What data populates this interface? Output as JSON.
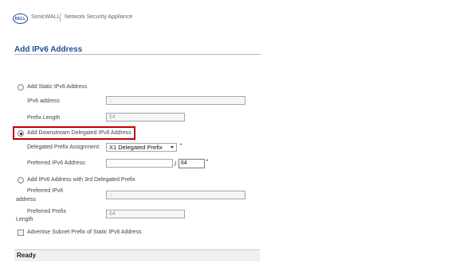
{
  "header": {
    "logo_text": "DELL",
    "brand": "SonicWALL",
    "product": "Network Security Appliance"
  },
  "page_title": "Add IPv6 Address",
  "static": {
    "radio_label": "Add Static IPv6 Address",
    "address_label": "IPv6 address",
    "address_value": "::",
    "prefix_label": "Prefix Length",
    "prefix_value": "64"
  },
  "downstream": {
    "radio_label": "Add Downstream Delegated IPv6 Address",
    "assignment_label": "Delegated Prefix Assignment:",
    "assignment_value": "X1 Delegated Prefix",
    "preferred_label": "Preferred IPv6 Address:",
    "preferred_value": "::",
    "separator": "/",
    "prefix_len_value": "64"
  },
  "third_party": {
    "radio_label": "Add IPv6 Address with 3rd Delegated Prefix",
    "preferred_address_label_1": "Preferred IPv6",
    "preferred_address_label_2": "address",
    "preferred_address_value": "::",
    "preferred_prefix_label_1": "Preferred Prefix",
    "preferred_prefix_label_2": "Length",
    "preferred_prefix_value": "64"
  },
  "advertise": {
    "checkbox_label": "Advertise Subnet Prefix of Static IPv6 Address",
    "checked": false
  },
  "status": {
    "text": "Ready"
  },
  "colors": {
    "title": "#1f4e96",
    "highlight": "#c00000"
  }
}
